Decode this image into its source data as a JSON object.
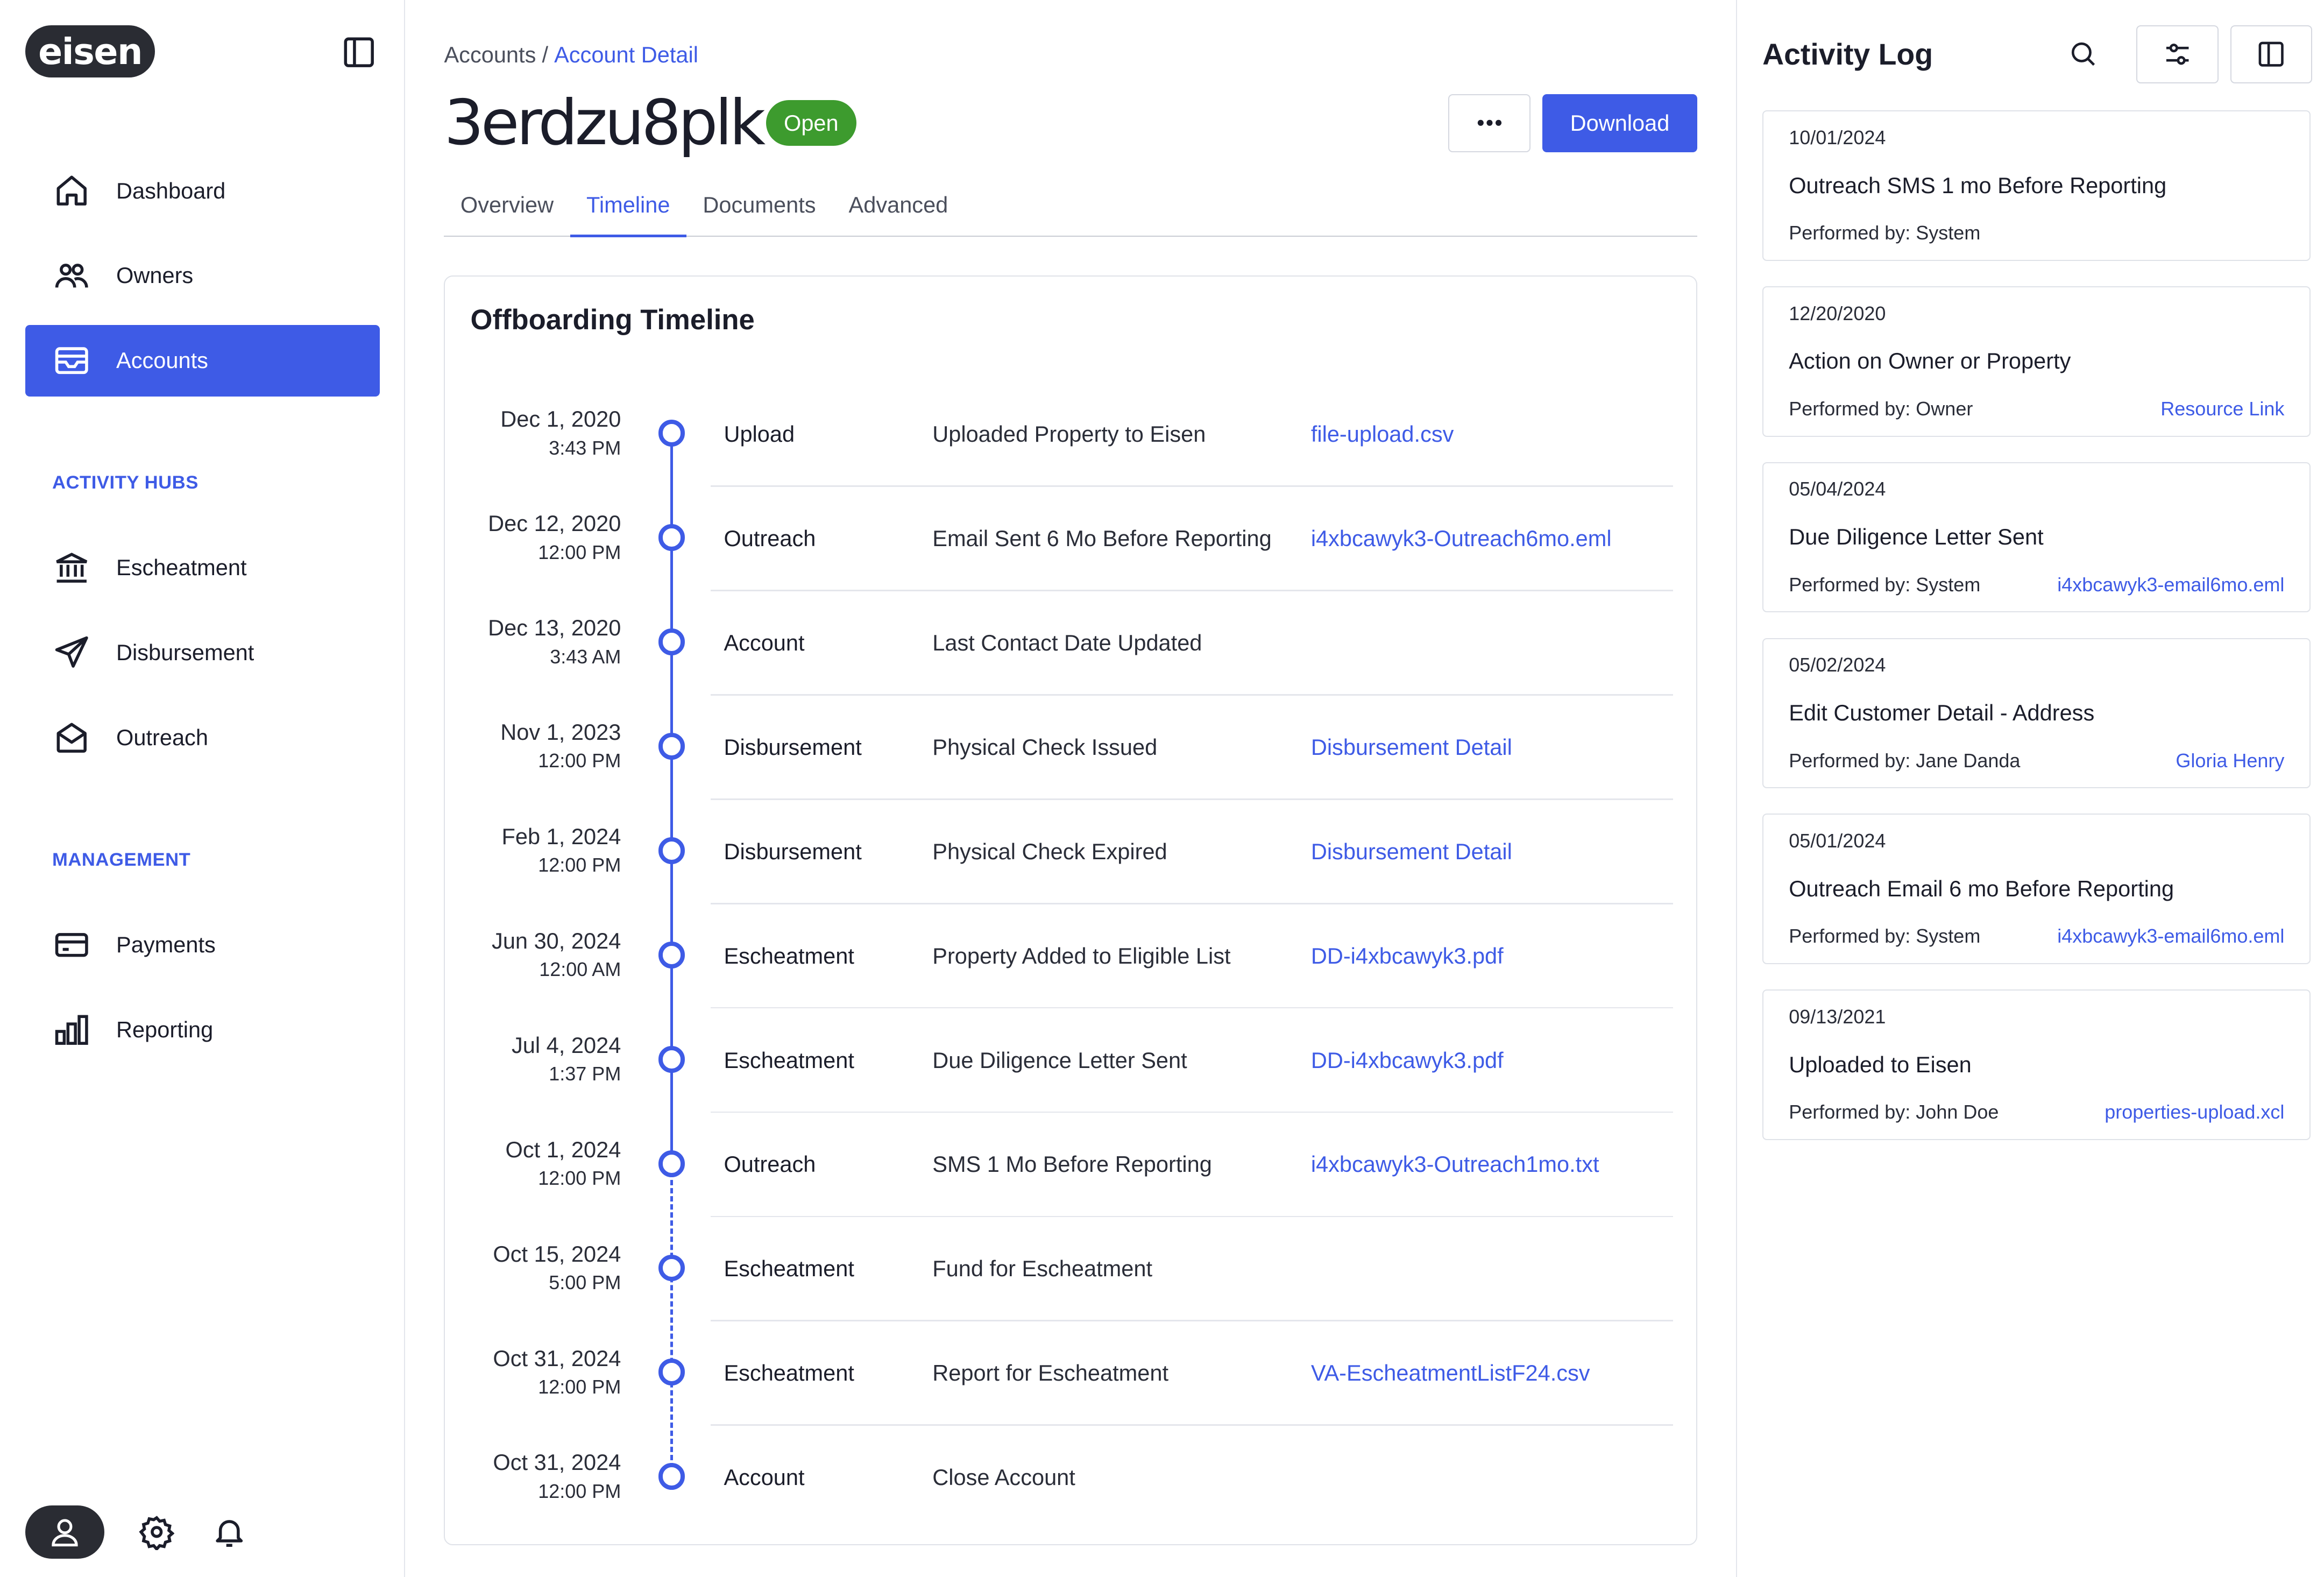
{
  "brand": {
    "logo_text": "eisen"
  },
  "sidebar": {
    "nav": [
      {
        "label": "Dashboard",
        "icon": "home-icon"
      },
      {
        "label": "Owners",
        "icon": "users-icon"
      },
      {
        "label": "Accounts",
        "icon": "wallet-icon",
        "active": true
      }
    ],
    "sections": [
      {
        "label": "ACTIVITY HUBS",
        "items": [
          {
            "label": "Escheatment",
            "icon": "bank-icon"
          },
          {
            "label": "Disbursement",
            "icon": "send-icon"
          },
          {
            "label": "Outreach",
            "icon": "mail-open-icon"
          }
        ]
      },
      {
        "label": "MANAGEMENT",
        "items": [
          {
            "label": "Payments",
            "icon": "credit-card-icon"
          },
          {
            "label": "Reporting",
            "icon": "bar-chart-icon"
          }
        ]
      }
    ]
  },
  "header": {
    "breadcrumb": {
      "parent": "Accounts",
      "separator": "/",
      "current": "Account Detail"
    },
    "title": "3erdzu8plk",
    "status": "Open",
    "download_label": "Download"
  },
  "tabs": [
    {
      "label": "Overview"
    },
    {
      "label": "Timeline",
      "active": true
    },
    {
      "label": "Documents"
    },
    {
      "label": "Advanced"
    }
  ],
  "timeline": {
    "title": "Offboarding Timeline",
    "events": [
      {
        "date": "Dec 1, 2020",
        "time": "3:43 PM",
        "category": "Upload",
        "description": "Uploaded Property to Eisen",
        "link": "file-upload.csv"
      },
      {
        "date": "Dec 12, 2020",
        "time": "12:00 PM",
        "category": "Outreach",
        "description": "Email Sent 6 Mo Before Reporting",
        "link": "i4xbcawyk3-Outreach6mo.eml"
      },
      {
        "date": "Dec 13, 2020",
        "time": "3:43 AM",
        "category": "Account",
        "description": "Last Contact Date Updated",
        "link": ""
      },
      {
        "date": "Nov 1, 2023",
        "time": "12:00 PM",
        "category": "Disbursement",
        "description": "Physical Check Issued",
        "link": "Disbursement Detail"
      },
      {
        "date": "Feb 1, 2024",
        "time": "12:00 PM",
        "category": "Disbursement",
        "description": "Physical Check Expired",
        "link": "Disbursement Detail"
      },
      {
        "date": "Jun 30, 2024",
        "time": "12:00 AM",
        "category": "Escheatment",
        "description": "Property Added to Eligible List",
        "link": "DD-i4xbcawyk3.pdf"
      },
      {
        "date": "Jul 4, 2024",
        "time": "1:37 PM",
        "category": "Escheatment",
        "description": "Due Diligence Letter Sent",
        "link": "DD-i4xbcawyk3.pdf"
      },
      {
        "date": "Oct 1, 2024",
        "time": "12:00 PM",
        "category": "Outreach",
        "description": "SMS 1 Mo Before Reporting",
        "link": "i4xbcawyk3-Outreach1mo.txt"
      },
      {
        "date": "Oct 15, 2024",
        "time": "5:00 PM",
        "category": "Escheatment",
        "description": "Fund for Escheatment",
        "link": ""
      },
      {
        "date": "Oct 31, 2024",
        "time": "12:00 PM",
        "category": "Escheatment",
        "description": "Report for Escheatment",
        "link": "VA-EscheatmentListF24.csv"
      },
      {
        "date": "Oct 31, 2024",
        "time": "12:00 PM",
        "category": "Account",
        "description": "Close Account",
        "link": ""
      }
    ]
  },
  "activity_log": {
    "title": "Activity Log",
    "entries": [
      {
        "date": "10/01/2024",
        "title": "Outreach SMS 1 mo Before Reporting",
        "performed_by": "Performed by: System",
        "link": ""
      },
      {
        "date": "12/20/2020",
        "title": "Action on Owner or Property",
        "performed_by": "Performed by: Owner",
        "link": "Resource Link"
      },
      {
        "date": "05/04/2024",
        "title": "Due Diligence Letter Sent",
        "performed_by": "Performed by: System",
        "link": "i4xbcawyk3-email6mo.eml"
      },
      {
        "date": "05/02/2024",
        "title": "Edit Customer Detail - Address",
        "performed_by": "Performed by: Jane Danda",
        "link": "Gloria Henry"
      },
      {
        "date": "05/01/2024",
        "title": "Outreach Email 6 mo Before Reporting",
        "performed_by": "Performed by: System",
        "link": "i4xbcawyk3-email6mo.eml"
      },
      {
        "date": "09/13/2021",
        "title": "Uploaded to Eisen",
        "performed_by": "Performed by: John Doe",
        "link": "properties-upload.xcl"
      }
    ]
  },
  "colors": {
    "accent": "#3e5be6",
    "status_open": "#3d9b2e",
    "dark": "#2a2c33"
  }
}
